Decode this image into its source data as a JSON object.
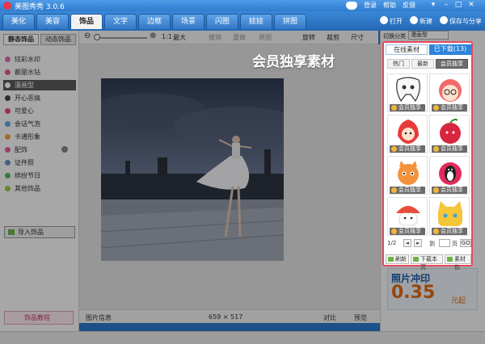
{
  "window": {
    "title": "美图秀秀 3.0.6",
    "links": [
      "登录",
      "帮助",
      "反馈"
    ],
    "buttons": {
      "open": "打开",
      "new": "新建",
      "save_share": "保存与分享"
    }
  },
  "tabs": [
    "美化",
    "美容",
    "饰品",
    "文字",
    "边框",
    "场景",
    "闪图",
    "娃娃",
    "拼图"
  ],
  "active_tab": "饰品",
  "left_panel": {
    "subtabs": [
      "静态饰品",
      "动态饰品"
    ],
    "categories": [
      {
        "label": "炫彩水印",
        "icon": "star-icon"
      },
      {
        "label": "靓丽水钻",
        "icon": "gem-icon"
      },
      {
        "label": "漫画型",
        "icon": "comic-icon",
        "selected": true
      },
      {
        "label": "开心恶搞",
        "icon": "glasses-icon"
      },
      {
        "label": "可爱心",
        "icon": "heart-icon"
      },
      {
        "label": "会话气泡",
        "icon": "bubble-icon"
      },
      {
        "label": "卡通形象",
        "icon": "cartoon-icon"
      },
      {
        "label": "配饰",
        "icon": "accessory-icon"
      },
      {
        "label": "证件照",
        "icon": "id-icon"
      },
      {
        "label": "缤纷节日",
        "icon": "festival-icon"
      },
      {
        "label": "其他饰品",
        "icon": "other-icon"
      }
    ],
    "import_label": "导入饰品",
    "tutorial_label": "饰品教程"
  },
  "toolbar": {
    "max_label": "最大",
    "items": [
      "撤销",
      "重做",
      "原图",
      "旋转",
      "裁剪",
      "尺寸"
    ]
  },
  "bottom_bar": {
    "image_info": "图片信息",
    "dimensions": "659 × 517",
    "compare": "对比",
    "preview": "预览"
  },
  "right_panel": {
    "switch_label": "切换分类",
    "select_value": "漫画型"
  },
  "popup": {
    "tabs": [
      "在线素材",
      "已下载(13)"
    ],
    "subtabs": [
      "热门",
      "最新",
      "会员独享"
    ],
    "tiles": [
      {
        "label": "会员独享",
        "color": "#ffffff",
        "face": "#f7f7f7"
      },
      {
        "label": "会员独享",
        "color": "#ffffff",
        "face": "#f26a6a"
      },
      {
        "label": "会员独享",
        "color": "#ffffff",
        "face": "#e93b3b"
      },
      {
        "label": "会员独享",
        "color": "#ffffff",
        "face": "#d7263d"
      },
      {
        "label": "会员独享",
        "color": "#ffffff",
        "face": "#f4923c"
      },
      {
        "label": "会员独享",
        "color": "#ffffff",
        "face": "#e42a5b"
      },
      {
        "label": "会员独享",
        "color": "#ffffff",
        "face": "#e94d3a"
      },
      {
        "label": "会员独享",
        "color": "#ffffff",
        "face": "#f5c53a"
      }
    ],
    "pager": {
      "page": "1/2",
      "go_to": "到",
      "page_unit": "页",
      "go": "GO"
    },
    "buttons": [
      "刷新",
      "下载本页",
      "素材包"
    ]
  },
  "callout": "会员独享素材",
  "ad": {
    "title": "照片冲印",
    "price": "0.35",
    "unit": "元起"
  },
  "colors": {
    "accent": "#2d84d8",
    "highlight": "#e84a5f"
  }
}
